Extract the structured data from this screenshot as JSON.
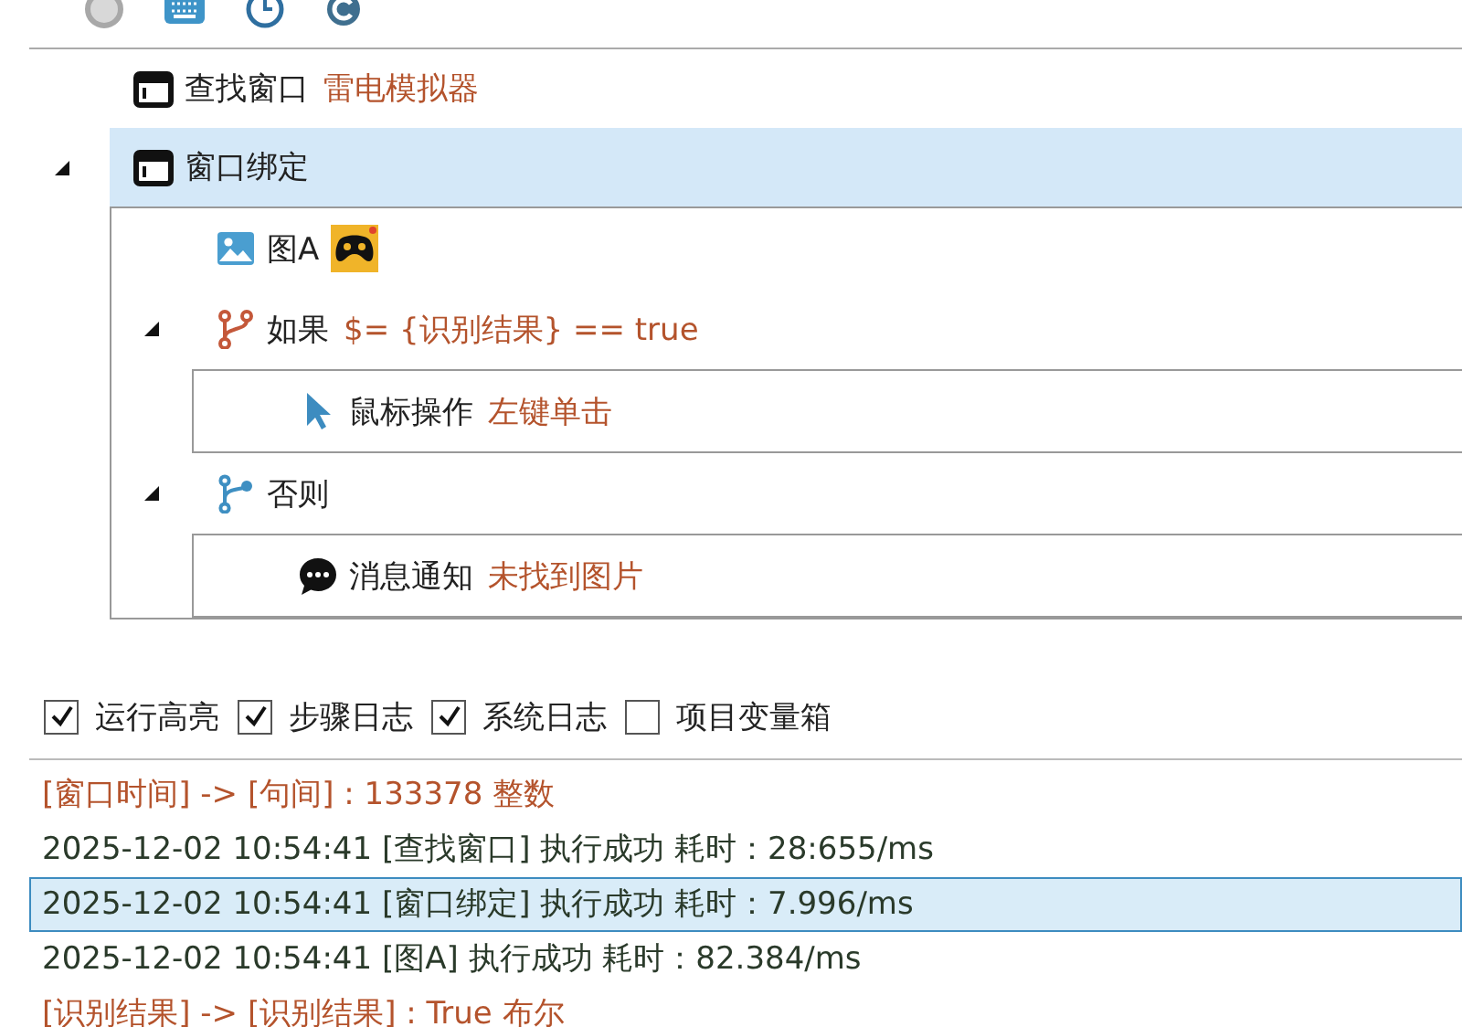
{
  "tree": [
    {
      "kind": "window",
      "label": "查找窗口",
      "param": "雷电模拟器",
      "selected": false
    },
    {
      "kind": "window",
      "label": "窗口绑定",
      "selected": true,
      "expanded": true,
      "children": [
        {
          "kind": "image",
          "label": "图A",
          "selected": false
        },
        {
          "kind": "branch",
          "label": "如果",
          "param": "$= {识别结果} == true",
          "selected": false,
          "expanded": true,
          "children": [
            {
              "kind": "mouse",
              "label": "鼠标操作",
              "param": "左键单击",
              "selected": false
            }
          ]
        },
        {
          "kind": "else",
          "label": "否则",
          "selected": false,
          "expanded": true,
          "children": [
            {
              "kind": "message",
              "label": "消息通知",
              "param": "未找到图片",
              "selected": false
            }
          ]
        }
      ]
    }
  ],
  "options": [
    {
      "label": "运行高亮",
      "checked": true
    },
    {
      "label": "步骤日志",
      "checked": true
    },
    {
      "label": "系统日志",
      "checked": true
    },
    {
      "label": "项目变量箱",
      "checked": false
    }
  ],
  "log": [
    {
      "kind": "variable",
      "text": "[窗口时间] -> [句间] : 133378 整数",
      "selected": false
    },
    {
      "kind": "step",
      "text": "2025-12-02 10:54:41 [查找窗口] 执行成功 耗时：28:655/ms",
      "selected": false
    },
    {
      "kind": "step",
      "text": "2025-12-02 10:54:41 [窗口绑定] 执行成功 耗时：7.996/ms",
      "selected": true
    },
    {
      "kind": "step",
      "text": "2025-12-02 10:54:41 [图A] 执行成功 耗时：82.384/ms",
      "selected": false
    },
    {
      "kind": "variable",
      "text": "[识别结果] -> [识别结果] : True 布尔",
      "selected": false
    }
  ]
}
